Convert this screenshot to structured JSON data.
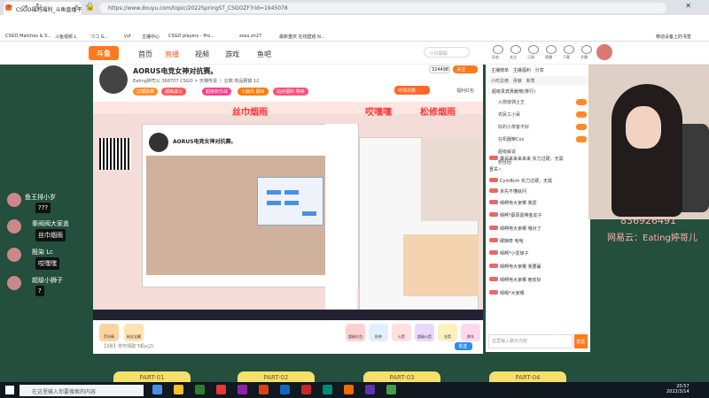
{
  "browser": {
    "tab_title": "CSGO福利福利_斗鱼直播平台",
    "tab_close": "×",
    "new_tab": "+",
    "window_controls": "— ☐ ✕",
    "url": "https://www.douyu.com/topic/2022SpringST_CSGOZF?rid=1945078",
    "bookmarks": [
      "CSGO Matches & S...",
      "斗鱼视频 L",
      "つコ G...",
      "yyt",
      "主播中心",
      "CSGO players - Pro...",
      "zoxx.zn27",
      "最新重庆 在线壁纸 N...",
      "移动设备上的书签"
    ]
  },
  "site": {
    "logo": "斗鱼",
    "nav": [
      "首页",
      "直播",
      "视频",
      "游戏",
      "鱼吧"
    ],
    "search_placeholder": "小红聪聪",
    "header_icons": [
      "历史",
      "关注",
      "订阅",
      "直播",
      "下载",
      "开播"
    ]
  },
  "room": {
    "title": "AORUS电竞女神对抗赛。",
    "tags": "Eating婷司乂  368707  CSGO > 天梯传说  ☆ 云端  商品橱窗 12",
    "pills": [
      {
        "label": "过期勋章",
        "color": "#ff8c2a"
      },
      {
        "label": "超级战斗",
        "color": "#ff5a5a"
      },
      {
        "label": "超级积分战",
        "color": "#ff3c8c"
      },
      {
        "label": "小旋风 超级",
        "color": "#ff7a00"
      },
      {
        "label": "站点福利 等级",
        "color": "#ff4f7a"
      }
    ],
    "follow_count": "324498",
    "follow_label": "关注",
    "kxc_label": "可领次数",
    "fudai_label": "福利红包"
  },
  "video": {
    "banner_texts": [
      "丝巾烟雨",
      "哎嘿嘿",
      "松修烟雨"
    ],
    "inner_title": "AORUS电竞女神对抗赛。",
    "part_labels": [
      "PART-01",
      "PART-02",
      "PART-03",
      "PART-04"
    ],
    "gifts": [
      "荧光棒",
      "粉丝宝藏",
      "超级礼包",
      "奶茶",
      "火箭",
      "超级火箭",
      "金箭",
      "跑车"
    ],
    "send_placeholder": "【2张】你可领取飞机x(2)",
    "send_button": "发送"
  },
  "sidebar": {
    "tabs": [
      "主播榜单",
      "主播福利",
      "分享"
    ],
    "rank_tabs": [
      "小时总榜",
      "贡献",
      "新秀"
    ],
    "rank_title": "超级贵宾贡献榜(排行)",
    "rank_rows": [
      "火箭兽骑土王",
      "农民工小呆",
      "好的小茶客不好",
      "在机器嘛Cxx",
      "超级解说",
      "粉丝团"
    ],
    "messages": [
      "薯哥来来来来来 实力过硬，无需",
      "晋关~",
      "CymBcm 实力过硬，无需",
      "京先不懂就问",
      "晴啊电大家哪 我爱",
      "晴啊*蔡辰嘉带金友子",
      "晴啊电大家哪 哦对了",
      "碳娘奇 哈哈",
      "晴啊*小爱妹子",
      "晴啊电大家哪 我要赢",
      "晴啊电大家哪 晚安好",
      "晴嗯*大家哪"
    ],
    "chat_placeholder": "这里输入聊天内容",
    "chat_send": "发送"
  },
  "overlay": {
    "qq": "836926491",
    "netease": "网易云：Eating婷哥儿",
    "left_chat": [
      {
        "name": "鱼王排小岁",
        "bubble": "???"
      },
      {
        "name": "秦阀阀大家盖",
        "bubble": "丝巾烟雨"
      },
      {
        "name": "殷染 Lc",
        "bubble": "哎嘿嘿"
      },
      {
        "name": "超级小狮子",
        "bubble": "?"
      }
    ]
  },
  "taskbar": {
    "search_placeholder": "在这里输入你要搜索的内容",
    "time": "20:57",
    "date": "2022/3/14"
  },
  "colors": {
    "brand": "#ff7a1f",
    "danger": "#ff3434",
    "bg": "#234f3c"
  }
}
